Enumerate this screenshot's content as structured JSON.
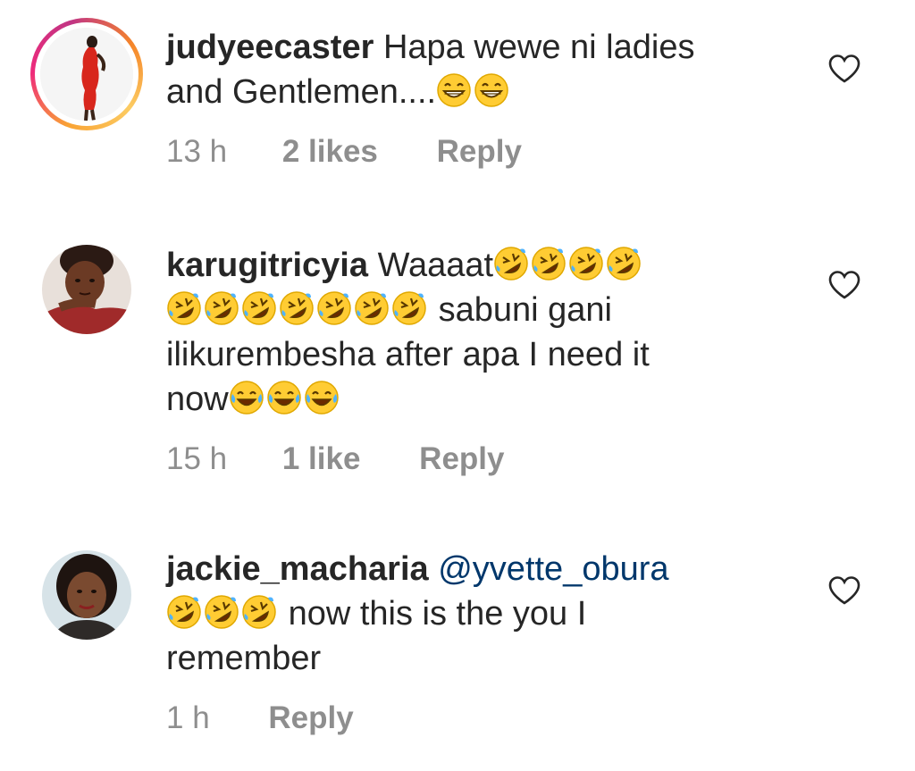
{
  "comments": [
    {
      "username": "judyeecaster",
      "text_line1": "Hapa wewe ni ladies",
      "text_line2": "and Gentlemen....",
      "emoji_after_line2": [
        "grinning-squint-emoji",
        "grinning-squint-emoji"
      ],
      "time": "13 h",
      "likes": "2 likes",
      "reply": "Reply",
      "has_story_ring": true
    },
    {
      "username": "karugitricyia",
      "text_part1": "Waaaat",
      "emoji_after_part1": [
        "rofl-emoji",
        "rofl-emoji",
        "rofl-emoji",
        "rofl-emoji"
      ],
      "emoji_line2": [
        "rofl-emoji",
        "rofl-emoji",
        "rofl-emoji",
        "rofl-emoji",
        "rofl-emoji",
        "rofl-emoji",
        "rofl-emoji"
      ],
      "text_part2": "sabuni gani",
      "text_line3": "ilikurembesha after apa I need it",
      "text_line4": "now",
      "emoji_after_line4": [
        "tears-of-joy-emoji",
        "tears-of-joy-emoji",
        "tears-of-joy-emoji"
      ],
      "time": "15 h",
      "likes": "1 like",
      "reply": "Reply"
    },
    {
      "username": "jackie_macharia",
      "mention": "@yvette_obura",
      "emoji_line2": [
        "rofl-emoji",
        "rofl-emoji",
        "rofl-emoji"
      ],
      "text_part": "now this is the you I",
      "text_line3": "remember",
      "time": "1 h",
      "reply": "Reply"
    }
  ],
  "colors": {
    "text": "#262626",
    "meta": "#8e8e8e",
    "mention": "#00376b",
    "emoji_yellow": "#ffcc33"
  },
  "icons": {
    "like": "heart-outline-icon"
  }
}
